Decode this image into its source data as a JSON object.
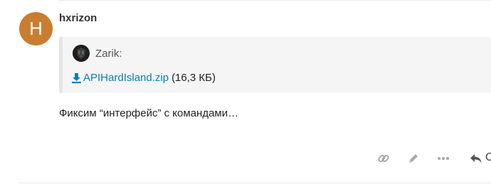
{
  "post": {
    "username": "hxrizon",
    "avatar_letter": "H",
    "avatar_color": "#c97d2f",
    "quote": {
      "author": "Zarik:",
      "attachment_name": "APIHardIsland.zip",
      "attachment_size": "(16,3 КБ)",
      "download_icon": "download-icon"
    },
    "message": "Фиксим “интерфейс” с командами…",
    "actions": {
      "link_icon": "link-icon",
      "edit_icon": "pencil-icon",
      "more_icon": "ellipsis-icon",
      "reply_icon": "reply-icon",
      "reply_label": "O"
    }
  }
}
